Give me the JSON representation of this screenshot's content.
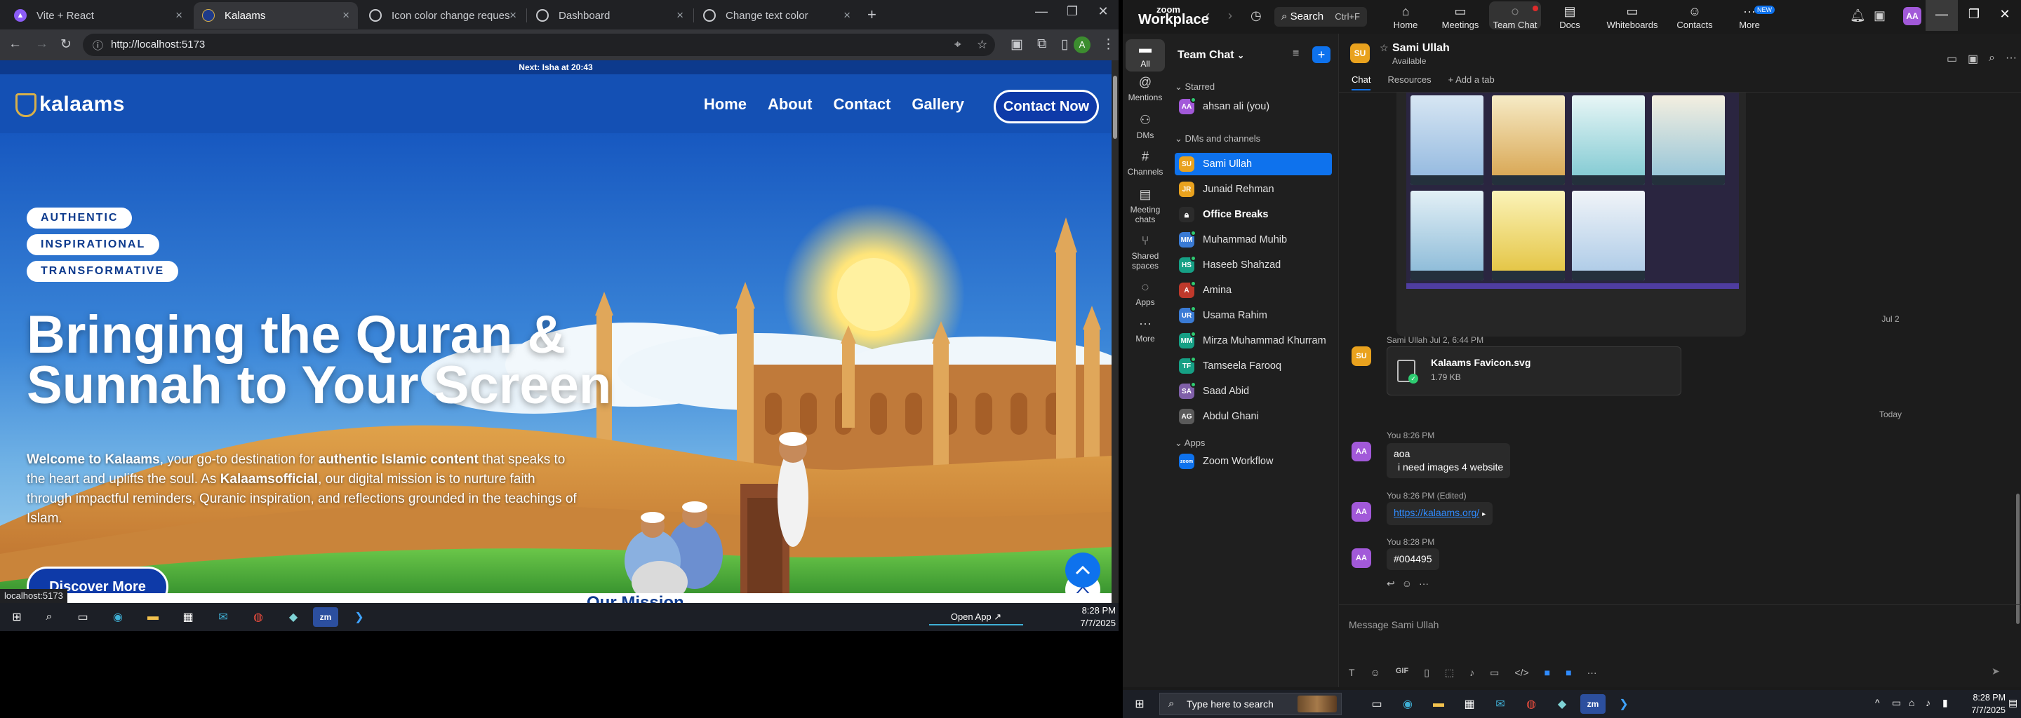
{
  "chrome": {
    "tabs": [
      {
        "label": "Vite + React",
        "icon": "vite-icon",
        "active": false
      },
      {
        "label": "Kalaams",
        "icon": "kalaams-icon",
        "active": true
      },
      {
        "label": "Icon color change request",
        "icon": "chatgpt-icon",
        "active": false
      },
      {
        "label": "Dashboard",
        "icon": "chatgpt-icon",
        "active": false
      },
      {
        "label": "Change text color",
        "icon": "chatgpt-icon",
        "active": false
      }
    ],
    "url": "http://localhost:5173",
    "status_url": "localhost:5173",
    "profile_initial": "A"
  },
  "site": {
    "prayer_bar": "Next: Isha at 20:43",
    "logo": "kalaams",
    "nav": [
      "Home",
      "About",
      "Contact",
      "Gallery"
    ],
    "nav_cta": "Contact Now",
    "pills": [
      "AUTHENTIC",
      "INSPIRATIONAL",
      "TRANSFORMATIVE"
    ],
    "headline_line1": "Bringing the Quran &",
    "headline_line2": "Sunnah to Your Screen",
    "intro": {
      "p1": "Welcome to Kalaams",
      "p2": ", your go-to destination for ",
      "p3": "authentic Islamic content",
      "p4": " that speaks to the heart and uplifts the soul. As ",
      "p5": "Kalaamsofficial",
      "p6": ", our digital mission is to nurture faith through impactful reminders, Quranic inspiration, and reflections grounded in the teachings of Islam."
    },
    "cta": "Discover More",
    "next_section_peek": "Our Mission"
  },
  "left_taskbar": {
    "open_app": "Open App ↗",
    "time": "8:28 PM",
    "date": "7/7/2025"
  },
  "zoom": {
    "brand_top": "zoom",
    "brand_bottom": "Workplace",
    "search_label": "Search",
    "search_shortcut": "Ctrl+F",
    "nav": [
      {
        "label": "Home",
        "icon": "home-icon"
      },
      {
        "label": "Meetings",
        "icon": "video-icon"
      },
      {
        "label": "Team Chat",
        "icon": "chat-icon"
      },
      {
        "label": "Docs",
        "icon": "doc-icon"
      },
      {
        "label": "Whiteboards",
        "icon": "whiteboard-icon"
      },
      {
        "label": "Contacts",
        "icon": "contacts-icon"
      },
      {
        "label": "More",
        "icon": "more-icon"
      }
    ],
    "new_badge": "NEW",
    "user_initials": "AA",
    "rail": [
      {
        "label": "All",
        "icon": "chat-bubble-icon"
      },
      {
        "label": "Mentions",
        "icon": "at-icon"
      },
      {
        "label": "DMs",
        "icon": "people-icon"
      },
      {
        "label": "Channels",
        "icon": "hash-icon"
      },
      {
        "label": "Meeting chats",
        "icon": "calendar-icon"
      },
      {
        "label": "Shared spaces",
        "icon": "share-icon"
      },
      {
        "label": "Apps",
        "icon": "apps-icon"
      },
      {
        "label": "More",
        "icon": "ellipsis-icon"
      }
    ],
    "list_title": "Team Chat",
    "sections": {
      "starred": "Starred",
      "dms": "DMs and channels",
      "apps": "Apps"
    },
    "starred": [
      {
        "name": "ahsan ali (you)",
        "initials": "AA",
        "color": "#a259d9"
      }
    ],
    "contacts": [
      {
        "name": "Sami Ullah",
        "initials": "SU",
        "color": "#e9a21e",
        "selected": true
      },
      {
        "name": "Junaid Rehman",
        "initials": "JR",
        "color": "#e9a21e"
      },
      {
        "name": "Office Breaks",
        "initials": "",
        "color": "#2b2b2b",
        "bold": true
      },
      {
        "name": "Muhammad Muhib",
        "initials": "MM",
        "color": "#3a7bd5"
      },
      {
        "name": "Haseeb Shahzad",
        "initials": "HS",
        "color": "#16a085"
      },
      {
        "name": "Amina",
        "initials": "A",
        "color": "#c0392b"
      },
      {
        "name": "Usama Rahim",
        "initials": "UR",
        "color": "#3a7bd5"
      },
      {
        "name": "Mirza Muhammad Khurram",
        "initials": "MM",
        "color": "#16a085"
      },
      {
        "name": "Tamseela Farooq",
        "initials": "TF",
        "color": "#16a085"
      },
      {
        "name": "Saad Abid",
        "initials": "SA",
        "color": "#7f5fa8"
      },
      {
        "name": "Abdul Ghani",
        "initials": "AG",
        "color": "#5a5a5a"
      }
    ],
    "apps": [
      {
        "name": "Zoom Workflow",
        "initials": "zoom",
        "color": "#0e72ed"
      }
    ],
    "chat": {
      "name": "Sami Ullah",
      "status": "Available",
      "tabs": [
        "Chat",
        "Resources",
        "+ Add a tab"
      ],
      "date_1": "Jul 2",
      "file_meta": "Sami Ullah  Jul 2, 6:44 PM",
      "file_name": "Kalaams Favicon.svg",
      "file_size": "1.79 KB",
      "date_2": "Today",
      "msg1_meta": "You  8:26 PM",
      "msg1_line1": "aoa",
      "msg1_line2": "i need images 4 website",
      "msg2_meta": "You  8:26 PM (Edited)",
      "msg2_link": "https://kalaams.org/",
      "msg3_meta": "You  8:28 PM",
      "msg3_text": "#004495",
      "composer_placeholder": "Message Sami Ullah"
    }
  },
  "right_taskbar": {
    "search_placeholder": "Type here to search",
    "time": "8:28 PM",
    "date": "7/7/2025"
  }
}
